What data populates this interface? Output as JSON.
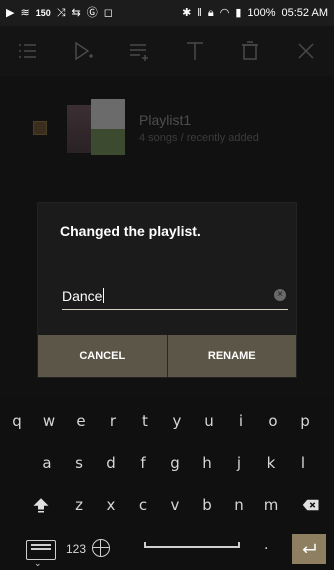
{
  "status_bar": {
    "battery": "100%",
    "time": "05:52 AM",
    "signal_label": "150",
    "icons": [
      "play-icon",
      "wifi-direct-icon",
      "shuffle-icon",
      "repeat-icon",
      "eq-icon",
      "window-icon",
      "bluetooth-icon",
      "equalizer-icon",
      "lock-icon",
      "wifi-icon",
      "battery-icon"
    ]
  },
  "toolbar": {
    "icons": [
      "checklist-icon",
      "play-next-icon",
      "add-to-queue-icon",
      "rename-text-icon",
      "trash-icon",
      "close-icon"
    ]
  },
  "playlist": {
    "title": "Playlist1",
    "subtitle": "4 songs / recently added"
  },
  "dialog": {
    "title": "Changed the playlist.",
    "input_value": "Dance",
    "cancel_label": "CANCEL",
    "rename_label": "RENAME"
  },
  "keyboard": {
    "row1": [
      "q",
      "w",
      "e",
      "r",
      "t",
      "y",
      "u",
      "i",
      "o",
      "p"
    ],
    "row2": [
      "a",
      "s",
      "d",
      "f",
      "g",
      "h",
      "j",
      "k",
      "l"
    ],
    "row3": [
      "z",
      "x",
      "c",
      "v",
      "b",
      "n",
      "m"
    ],
    "numbers_label": "123",
    "period": ".",
    "accent_color": "#8e7f61"
  }
}
